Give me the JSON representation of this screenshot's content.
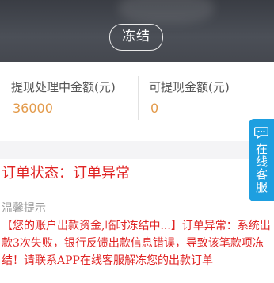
{
  "header": {
    "freeze_button_label": "冻结"
  },
  "balances": {
    "processing": {
      "label": "提现处理中金额(元)",
      "value": "36000"
    },
    "withdrawable": {
      "label": "可提现金额(元)",
      "value": "0"
    }
  },
  "order": {
    "status_text": "订单状态：订单异常",
    "tip_title": "温馨提示",
    "tip_body": "【您的账户出款资金,临时冻结中...】订单异常：系统出款3次失败，银行反馈出款信息错误，导致该笔款项冻结！请联系APP在线客服解冻您的出款订单"
  },
  "side_tab": {
    "label": "在线客服",
    "icon": "chat-bubble-icon"
  },
  "colors": {
    "accent_orange": "#e39a4a",
    "alert_red": "#e02424",
    "tab_blue": "#1e9fe0"
  }
}
